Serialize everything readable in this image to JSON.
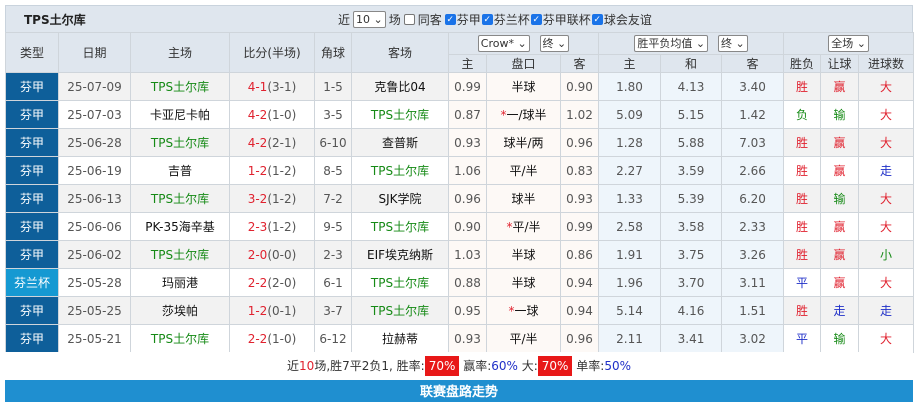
{
  "title": "TPS土尔库",
  "filters": {
    "recent_prefix": "近",
    "recent_count": "10",
    "recent_suffix": "场",
    "same_venue": "同客",
    "same_venue_checked": false,
    "leagues": [
      {
        "label": "芬甲",
        "checked": true
      },
      {
        "label": "芬兰杯",
        "checked": true
      },
      {
        "label": "芬甲联杯",
        "checked": true
      },
      {
        "label": "球会友谊",
        "checked": true
      }
    ]
  },
  "selects": {
    "company": "Crow*",
    "hc_time": "终",
    "odds_type": "胜平负均值",
    "odds_time": "终",
    "period": "全场"
  },
  "headers": {
    "type": "类型",
    "date": "日期",
    "home": "主场",
    "score": "比分(半场)",
    "corner": "角球",
    "away": "客场",
    "hc_home": "主",
    "hc_line": "盘口",
    "hc_away": "客",
    "o_home": "主",
    "o_draw": "和",
    "o_away": "客",
    "wl": "胜负",
    "ah": "让球",
    "ou": "进球数"
  },
  "colors": {
    "type_league": "#0e5f9a",
    "type_cup": "#1599d2",
    "team": "#168a16",
    "score": "#e0222f",
    "badge": "#e81818",
    "bar": "#1f8fd0"
  },
  "rows": [
    {
      "type": "芬甲",
      "cup": false,
      "date": "25-07-09",
      "home": "TPS土尔库",
      "home_hl": true,
      "ft": "4-1",
      "ht": "(3-1)",
      "corner": "1-5",
      "away": "克鲁比04",
      "away_hl": false,
      "hh": "0.99",
      "star": "",
      "line": "半球",
      "ha": "0.90",
      "oh": "1.80",
      "od": "4.13",
      "oa": "3.40",
      "wl": "胜",
      "ah": "赢",
      "ou": "大"
    },
    {
      "type": "芬甲",
      "cup": false,
      "date": "25-07-03",
      "home": "卡亚尼卡帕",
      "home_hl": false,
      "ft": "4-2",
      "ht": "(1-0)",
      "corner": "3-5",
      "away": "TPS土尔库",
      "away_hl": true,
      "hh": "0.87",
      "star": "*",
      "line": "一/球半",
      "ha": "1.02",
      "oh": "5.09",
      "od": "5.15",
      "oa": "1.42",
      "wl": "负",
      "ah": "输",
      "ou": "大"
    },
    {
      "type": "芬甲",
      "cup": false,
      "date": "25-06-28",
      "home": "TPS土尔库",
      "home_hl": true,
      "ft": "4-2",
      "ht": "(2-1)",
      "corner": "6-10",
      "away": "查普斯",
      "away_hl": false,
      "hh": "0.93",
      "star": "",
      "line": "球半/两",
      "ha": "0.96",
      "oh": "1.28",
      "od": "5.88",
      "oa": "7.03",
      "wl": "胜",
      "ah": "赢",
      "ou": "大"
    },
    {
      "type": "芬甲",
      "cup": false,
      "date": "25-06-19",
      "home": "吉普",
      "home_hl": false,
      "ft": "1-2",
      "ht": "(1-2)",
      "corner": "8-5",
      "away": "TPS土尔库",
      "away_hl": true,
      "hh": "1.06",
      "star": "",
      "line": "平/半",
      "ha": "0.83",
      "oh": "2.27",
      "od": "3.59",
      "oa": "2.66",
      "wl": "胜",
      "ah": "赢",
      "ou": "走"
    },
    {
      "type": "芬甲",
      "cup": false,
      "date": "25-06-13",
      "home": "TPS土尔库",
      "home_hl": true,
      "ft": "3-2",
      "ht": "(1-2)",
      "corner": "7-2",
      "away": "SJK学院",
      "away_hl": false,
      "hh": "0.96",
      "star": "",
      "line": "球半",
      "ha": "0.93",
      "oh": "1.33",
      "od": "5.39",
      "oa": "6.20",
      "wl": "胜",
      "ah": "输",
      "ou": "大"
    },
    {
      "type": "芬甲",
      "cup": false,
      "date": "25-06-06",
      "home": "PK-35海辛基",
      "home_hl": false,
      "ft": "2-3",
      "ht": "(1-2)",
      "corner": "9-5",
      "away": "TPS土尔库",
      "away_hl": true,
      "hh": "0.90",
      "star": "*",
      "line": "平/半",
      "ha": "0.99",
      "oh": "2.58",
      "od": "3.58",
      "oa": "2.33",
      "wl": "胜",
      "ah": "赢",
      "ou": "大"
    },
    {
      "type": "芬甲",
      "cup": false,
      "date": "25-06-02",
      "home": "TPS土尔库",
      "home_hl": true,
      "ft": "2-0",
      "ht": "(0-0)",
      "corner": "2-3",
      "away": "EIF埃克纳斯",
      "away_hl": false,
      "hh": "1.03",
      "star": "",
      "line": "半球",
      "ha": "0.86",
      "oh": "1.91",
      "od": "3.75",
      "oa": "3.26",
      "wl": "胜",
      "ah": "赢",
      "ou": "小"
    },
    {
      "type": "芬兰杯",
      "cup": true,
      "date": "25-05-28",
      "home": "玛丽港",
      "home_hl": false,
      "ft": "2-2",
      "ht": "(2-0)",
      "corner": "6-1",
      "away": "TPS土尔库",
      "away_hl": true,
      "hh": "0.88",
      "star": "",
      "line": "半球",
      "ha": "0.94",
      "oh": "1.96",
      "od": "3.70",
      "oa": "3.11",
      "wl": "平",
      "ah": "赢",
      "ou": "大"
    },
    {
      "type": "芬甲",
      "cup": false,
      "date": "25-05-25",
      "home": "莎埃帕",
      "home_hl": false,
      "ft": "1-2",
      "ht": "(0-1)",
      "corner": "3-7",
      "away": "TPS土尔库",
      "away_hl": true,
      "hh": "0.95",
      "star": "*",
      "line": "一球",
      "ha": "0.94",
      "oh": "5.14",
      "od": "4.16",
      "oa": "1.51",
      "wl": "胜",
      "ah": "走",
      "ou": "走"
    },
    {
      "type": "芬甲",
      "cup": false,
      "date": "25-05-21",
      "home": "TPS土尔库",
      "home_hl": true,
      "ft": "2-2",
      "ht": "(1-0)",
      "corner": "6-12",
      "away": "拉赫蒂",
      "away_hl": false,
      "hh": "0.93",
      "star": "",
      "line": "平/半",
      "ha": "0.96",
      "oh": "2.11",
      "od": "3.41",
      "oa": "3.02",
      "wl": "平",
      "ah": "输",
      "ou": "大"
    }
  ],
  "summary": {
    "p1": "近",
    "n": "10",
    "p2": "场,胜7平2负1, 胜率:",
    "win_rate": "70%",
    "p3": " 赢率:",
    "ah_rate": "60%",
    "p4": " 大:",
    "over_rate": "70%",
    "p5": " 单率:",
    "odd_rate": "50%"
  },
  "bottom_bar": "联赛盘路走势"
}
